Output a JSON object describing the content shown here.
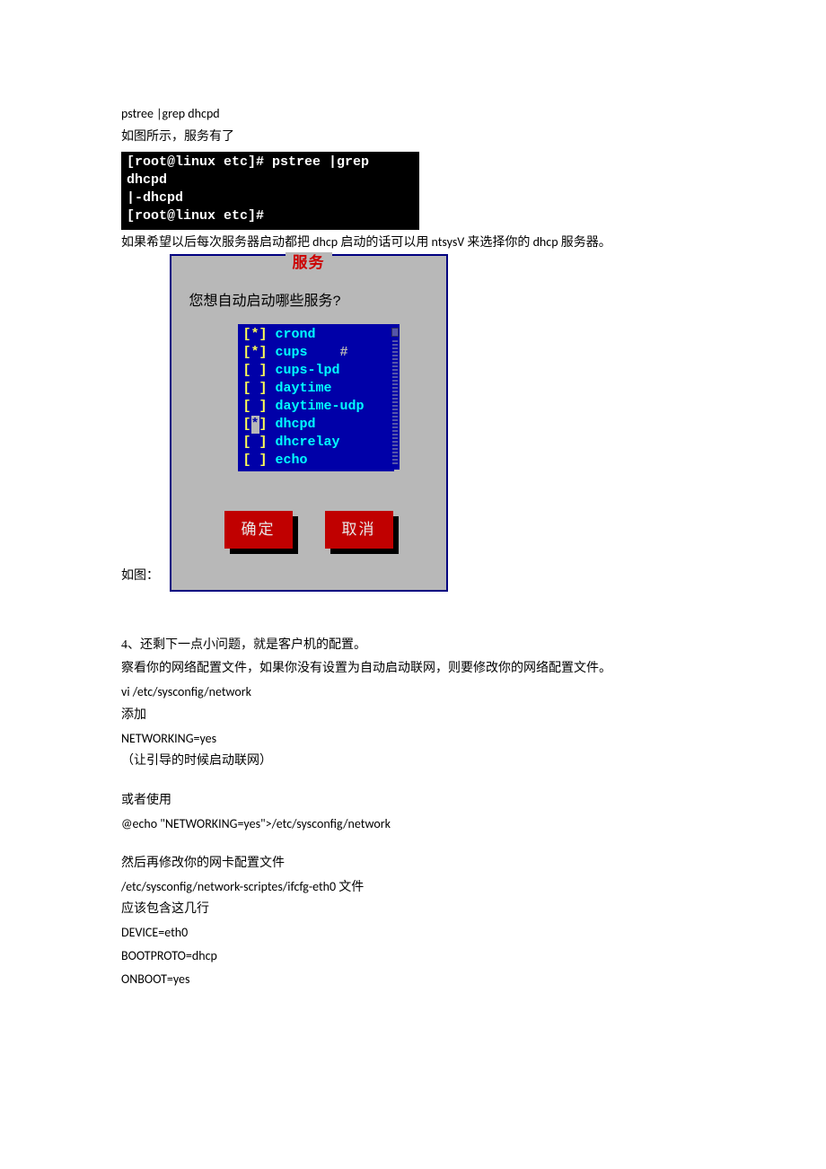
{
  "para": {
    "cmd1": "pstree |grep dhcpd",
    "line1": "如图所示，服务有了",
    "line2": "如果希望以后每次服务器启动都把 dhcp 启动的话可以用 ntsysV 来选择你的 dhcp 服务器。",
    "asFigure": "如图：",
    "sec4_l1": "4、还剩下一点小问题，就是客户机的配置。",
    "sec4_l2": "察看你的网络配置文件，如果你没有设置为自动启动联网，则要修改你的网络配置文件。",
    "sec4_l3": "vi /etc/sysconfig/network",
    "sec4_l4": "添加",
    "sec4_l5": "NETWORKING=yes",
    "sec4_l6": "（让引导的时候启动联网）",
    "sec4_l7": "或者使用",
    "sec4_l8": "@echo \"NETWORKING=yes\">/etc/sysconfig/network",
    "sec4_l9": "然后再修改你的网卡配置文件",
    "sec4_l10": "/etc/sysconfig/network-scriptes/ifcfg-eth0  文件",
    "sec4_l11": "应该包含这几行",
    "sec4_l12": "DEVICE=eth0",
    "sec4_l13": "BOOTPROTO=dhcp",
    "sec4_l14": "ONBOOT=yes"
  },
  "terminal": {
    "l1": "[root@linux etc]# pstree |grep dhcpd",
    "l2": "     |-dhcpd",
    "l3": "[root@linux etc]#"
  },
  "ntsysv": {
    "title": "服务",
    "question": "您想自动启动哪些服务?",
    "items": [
      {
        "mark": "[*]",
        "name": "crond"
      },
      {
        "mark": "[*]",
        "name": "cups"
      },
      {
        "mark": "[ ]",
        "name": "cups-lpd"
      },
      {
        "mark": "[ ]",
        "name": "daytime"
      },
      {
        "mark": "[ ]",
        "name": "daytime-udp"
      },
      {
        "mark": "[*]",
        "name": "dhcpd",
        "cursor": true
      },
      {
        "mark": "[ ]",
        "name": "dhcrelay"
      },
      {
        "mark": "[ ]",
        "name": "echo"
      }
    ],
    "ok": "确定",
    "cancel": "取消"
  }
}
